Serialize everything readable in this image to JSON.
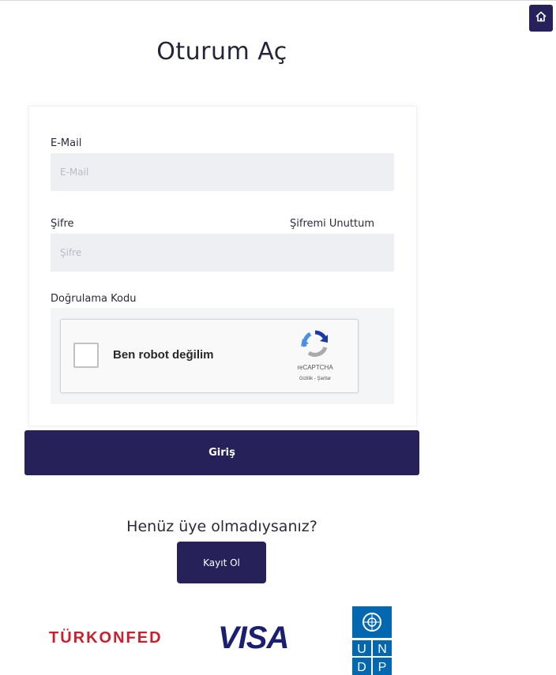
{
  "header": {
    "home_icon": "home-icon",
    "title": "Oturum Aç"
  },
  "form": {
    "email": {
      "label": "E-Mail",
      "placeholder": "E-Mail",
      "value": ""
    },
    "password": {
      "label": "Şifre",
      "placeholder": "Şifre",
      "value": "",
      "forgot_link": "Şifremi Unuttum"
    },
    "captcha": {
      "label": "Doğrulama Kodu",
      "checkbox_label": "Ben robot değilim",
      "checked": false,
      "brand": "reCAPTCHA",
      "terms": "Gizlilik - Şartlar"
    },
    "submit_label": "Giriş"
  },
  "register": {
    "prompt": "Henüz üye olmadıysanız?",
    "button_label": "Kayıt Ol"
  },
  "sponsors": {
    "turkonfed": "TÜRKONFED",
    "visa": "VISA",
    "undp_letters": [
      "U",
      "N",
      "D",
      "P"
    ]
  },
  "colors": {
    "primary": "#262259",
    "input_bg": "#edeff3",
    "turkonfed_red": "#c8202f",
    "visa_blue": "#1a1f71",
    "undp_blue": "#0468b1"
  }
}
